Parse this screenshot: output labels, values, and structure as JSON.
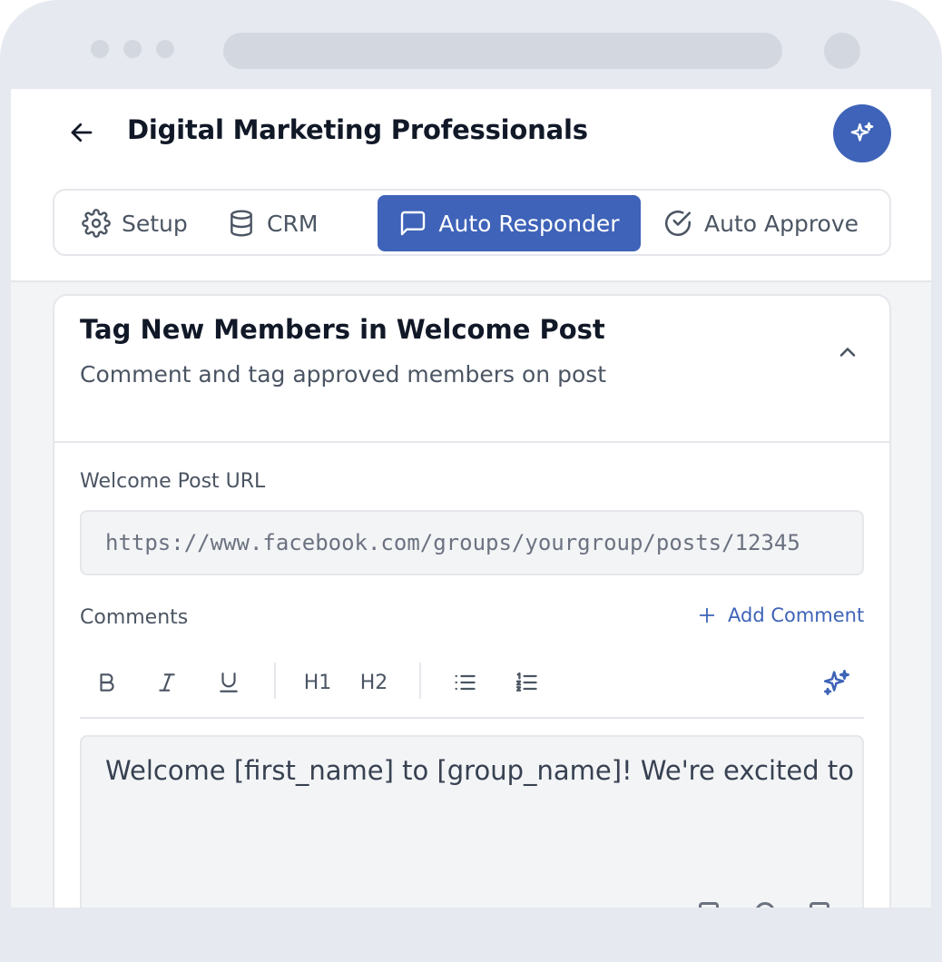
{
  "header": {
    "title": "Digital Marketing Professionals",
    "back_icon": "arrow-left-icon",
    "ai_icon": "sparkles-icon"
  },
  "tabs": [
    {
      "label": "Setup",
      "icon": "gear-icon",
      "active": false
    },
    {
      "label": "CRM",
      "icon": "database-icon",
      "active": false
    },
    {
      "label": "Auto Responder",
      "icon": "message-square-icon",
      "active": true
    },
    {
      "label": "Auto Approve",
      "icon": "check-circle-icon",
      "active": false
    }
  ],
  "card": {
    "title": "Tag New Members in Welcome Post",
    "subtitle": "Comment and tag approved members on post",
    "url_label": "Welcome Post URL",
    "url_placeholder": "https://www.facebook.com/groups/yourgroup/posts/12345",
    "comments_label": "Comments",
    "add_comment_label": "Add Comment",
    "toolbar": {
      "h1": "H1",
      "h2": "H2"
    },
    "editor_text": "Welcome [first_name] to [group_name]! We're excited to"
  },
  "colors": {
    "accent": "#3e63b8",
    "frame": "#e6e9ef",
    "surface": "#f3f4f6"
  }
}
